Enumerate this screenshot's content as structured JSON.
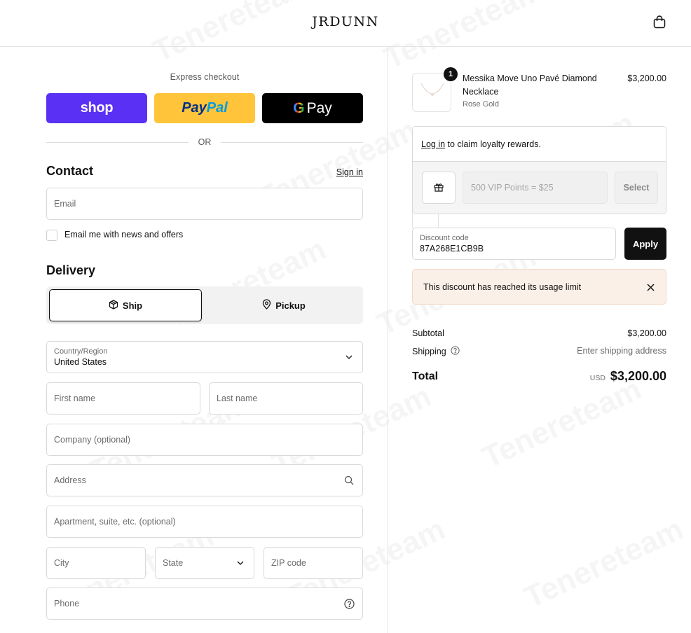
{
  "header": {
    "logo": "JRDUNN",
    "cart_icon": "shopping-bag-icon"
  },
  "express": {
    "label": "Express checkout",
    "shop_label": "shop",
    "paypal_part1": "Pay",
    "paypal_part2": "Pal",
    "gpay_g": "G",
    "gpay_label": "Pay",
    "or_text": "OR"
  },
  "contact": {
    "title": "Contact",
    "sign_in": "Sign in",
    "email_placeholder": "Email",
    "newsletter_label": "Email me with news and offers"
  },
  "delivery": {
    "title": "Delivery",
    "ship_label": "Ship",
    "pickup_label": "Pickup",
    "country_label": "Country/Region",
    "country_value": "United States",
    "first_name": "First name",
    "last_name": "Last name",
    "company": "Company (optional)",
    "address": "Address",
    "apartment": "Apartment, suite, etc. (optional)",
    "city": "City",
    "state": "State",
    "zip": "ZIP code",
    "phone": "Phone"
  },
  "order": {
    "quantity": "1",
    "product_name": "Messika Move Uno Pavé Diamond Necklace",
    "variant": "Rose Gold",
    "price": "$3,200.00"
  },
  "loyalty": {
    "login_link": "Log in",
    "text": "to claim loyalty rewards.",
    "points_placeholder": "500 VIP Points = $25",
    "select_label": "Select"
  },
  "discount": {
    "label": "Discount code",
    "value": "87A268E1CB9B",
    "apply_label": "Apply",
    "alert_text": "This discount has reached its usage limit"
  },
  "summary": {
    "subtotal_label": "Subtotal",
    "subtotal_value": "$3,200.00",
    "shipping_label": "Shipping",
    "shipping_value": "Enter shipping address",
    "total_label": "Total",
    "currency": "USD",
    "total_value": "$3,200.00"
  },
  "watermark": "Tenereteam"
}
